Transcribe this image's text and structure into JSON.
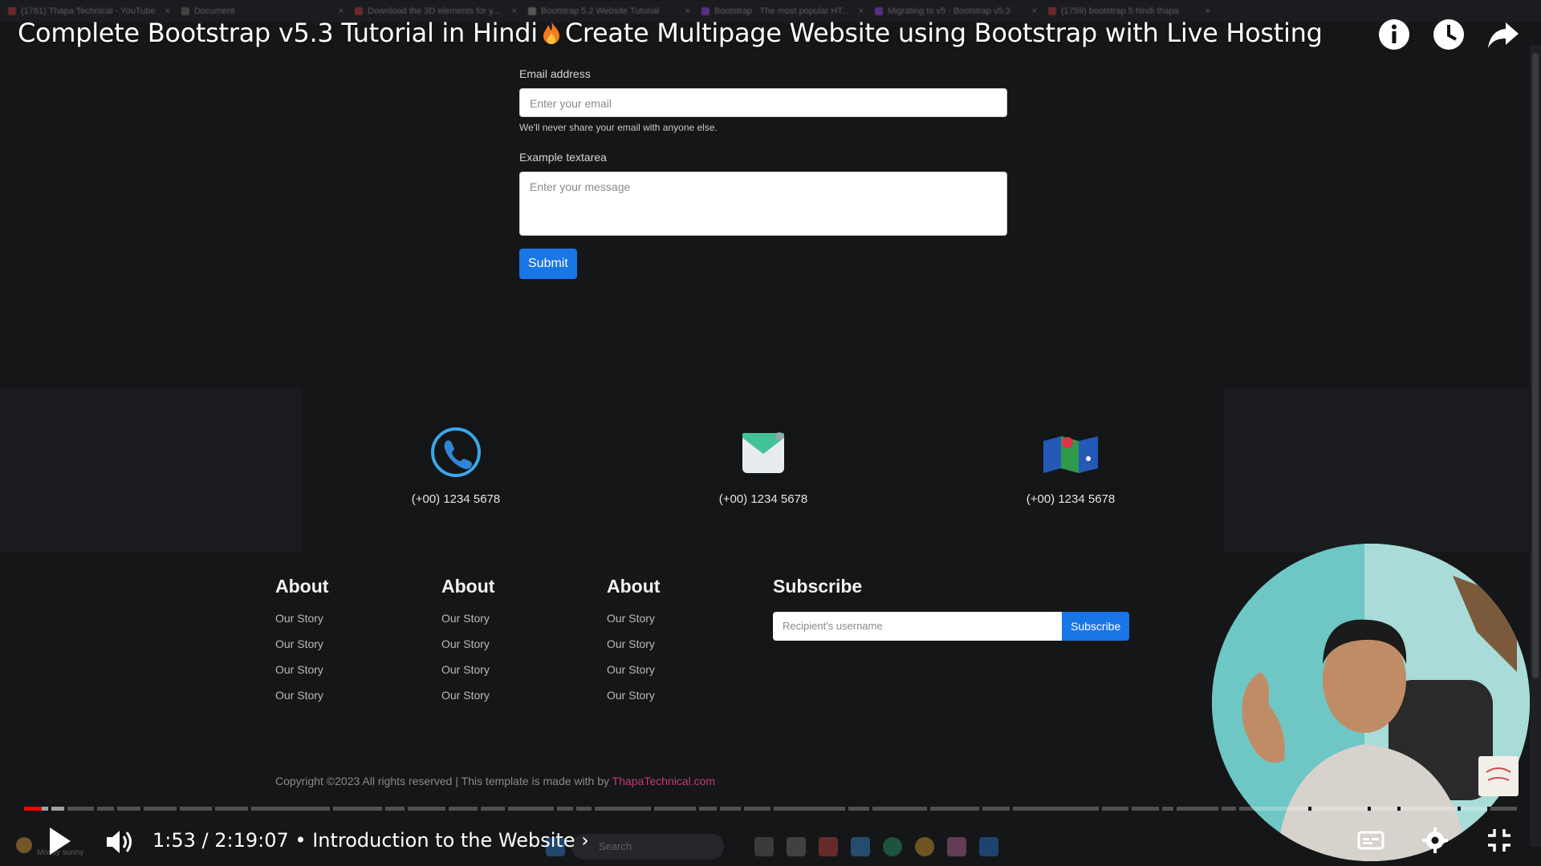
{
  "browser": {
    "tabs": [
      "(1761) Thapa Technical - YouTube",
      "Document",
      "Download the 3D elements for y...",
      "Bootstrap 5.2 Website Tutorial",
      "Bootstrap · The most popular HT...",
      "Migrating to v5 · Bootstrap v5.3",
      "(1759) bootstrap 5 hindi thapa"
    ]
  },
  "video": {
    "title_part1": "Complete Bootstrap v5.3 Tutorial in Hindi",
    "title_part2": "Create Multipage Website using Bootstrap with Live Hosting",
    "current_time": "1:53 / 2:19:07",
    "chapter": "• Introduction to the Website",
    "chapter_chevron": "›",
    "played_fraction": 0.012,
    "loaded_fraction": 0.028
  },
  "form": {
    "email_label": "Email address",
    "email_placeholder": "Enter your email",
    "email_help": "We'll never share your email with anyone else.",
    "textarea_label": "Example textarea",
    "textarea_placeholder": "Enter your message",
    "submit_label": "Submit"
  },
  "contact": {
    "items": [
      {
        "icon": "phone-icon",
        "text": "(+00) 1234 5678"
      },
      {
        "icon": "mail-icon",
        "text": "(+00) 1234 5678"
      },
      {
        "icon": "map-icon",
        "text": "(+00) 1234 5678"
      }
    ]
  },
  "footer": {
    "columns": [
      {
        "heading": "About",
        "links": [
          "Our Story",
          "Our Story",
          "Our Story",
          "Our Story"
        ]
      },
      {
        "heading": "About",
        "links": [
          "Our Story",
          "Our Story",
          "Our Story",
          "Our Story"
        ]
      },
      {
        "heading": "About",
        "links": [
          "Our Story",
          "Our Story",
          "Our Story",
          "Our Story"
        ]
      }
    ],
    "subscribe": {
      "heading": "Subscribe",
      "placeholder": "Recipient's username",
      "button": "Subscribe"
    },
    "copyright_text": "Copyright ©2023 All rights reserved | This template is made with by ",
    "copyright_link": "ThapaTechnical.com"
  },
  "taskbar": {
    "search_placeholder": "Search",
    "weather": "Mostly sunny"
  },
  "colors": {
    "accent": "#1976e6",
    "progress_red": "#ff0000",
    "background": "#151618"
  }
}
